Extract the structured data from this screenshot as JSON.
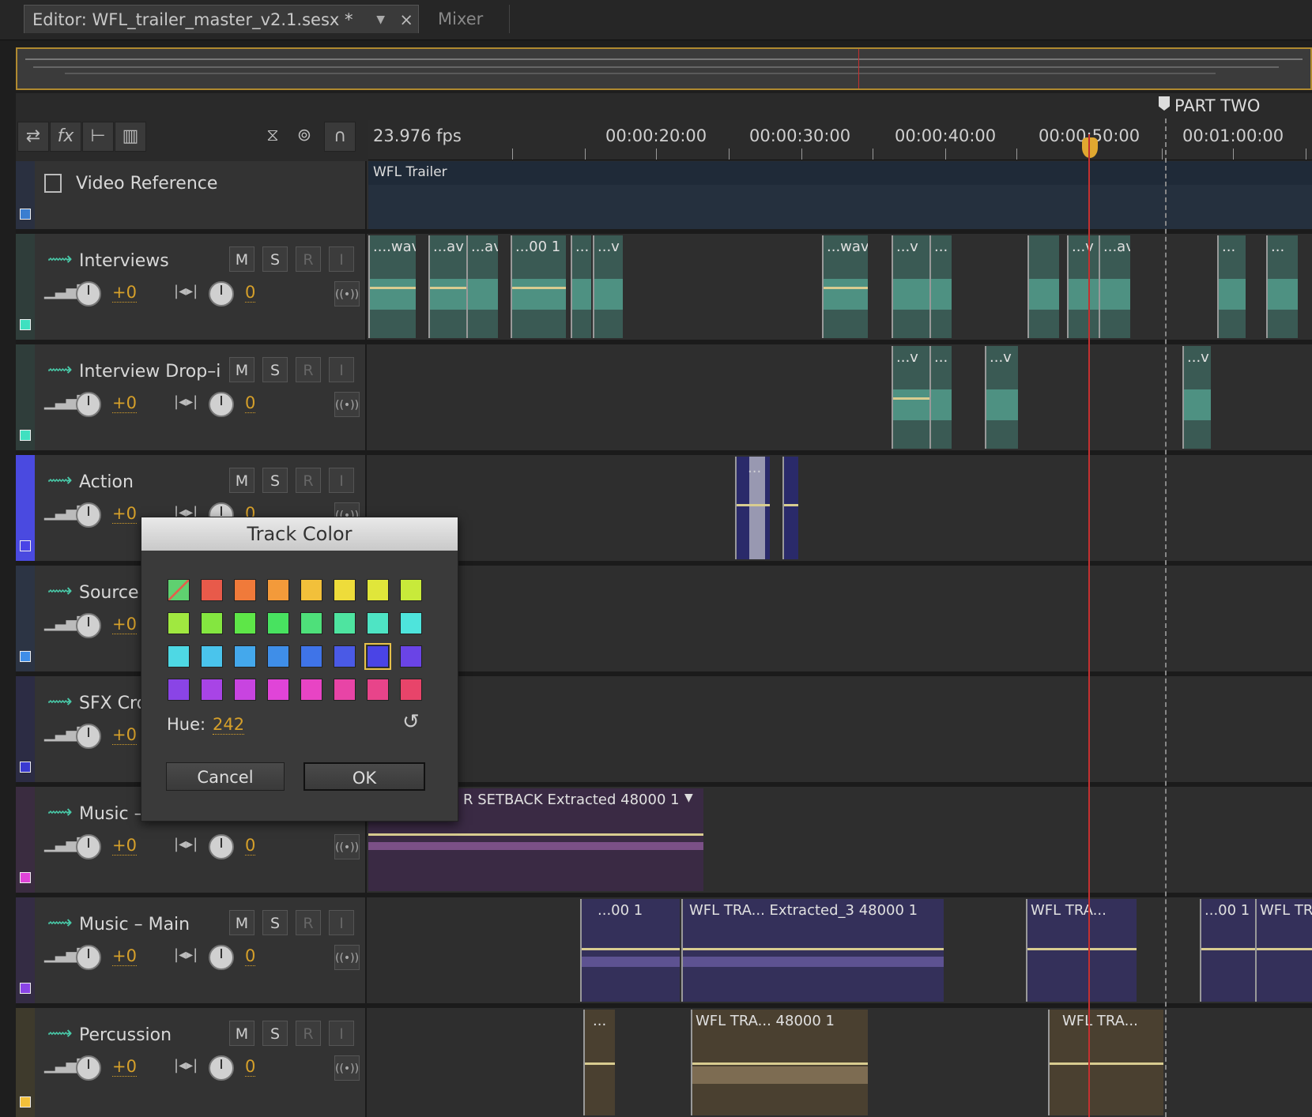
{
  "tabs": {
    "editor": "Editor: WFL_trailer_master_v2.1.sesx *",
    "mixer": "Mixer",
    "menu_glyph": "▼",
    "close_glyph": "×"
  },
  "marker": {
    "label": "PART TWO"
  },
  "toolbar": {
    "icons": [
      "swap-icon",
      "fx-icon",
      "send-icon",
      "meter-icon",
      "metronome-icon",
      "record-icon",
      "snap-magnet-icon"
    ],
    "glyphs": [
      "⇄",
      "fx",
      "⊢",
      "▥",
      "⧖",
      "⊚",
      "∩"
    ]
  },
  "ruler": {
    "fps": "23.976 fps",
    "times": [
      "00:00:20:00",
      "00:00:30:00",
      "00:00:40:00",
      "00:00:50:00",
      "00:01:00:00"
    ]
  },
  "video": {
    "name": "Video Reference",
    "clip": "WFL Trailer"
  },
  "tracks": [
    {
      "name": "Interviews",
      "vol": "+0",
      "pan": "0",
      "color": "#3fc2a0"
    },
    {
      "name": "Interview Drop–i",
      "vol": "+0",
      "pan": "0",
      "color": "#3fc2a0"
    },
    {
      "name": "Action",
      "vol": "+0",
      "pan": "0",
      "color": "#4a4ae0"
    },
    {
      "name": "Source",
      "vol": "+0",
      "pan": "0",
      "color": "#3a7ed0"
    },
    {
      "name": "SFX Cro",
      "vol": "+0",
      "pan": "0",
      "color": "#3a3ad0"
    },
    {
      "name": "Music –",
      "vol": "+0",
      "pan": "0",
      "color": "#c040c0"
    },
    {
      "name": "Music – Main",
      "vol": "+0",
      "pan": "0",
      "color": "#7a40e0"
    },
    {
      "name": "Percussion",
      "vol": "+0",
      "pan": "0",
      "color": "#d0b040"
    }
  ],
  "buttons": {
    "m": "M",
    "s": "S",
    "r": "R",
    "i": "I"
  },
  "clips": {
    "interviews": [
      "....wav",
      "...av",
      "...av",
      "...00 1",
      "...",
      "...v",
      "...wav",
      "...v",
      "...",
      "...v",
      "...av",
      "...",
      "..."
    ],
    "drop": [
      "...v",
      "...",
      "...v",
      "...v"
    ],
    "action": [
      "..."
    ],
    "music_sec": "R SETBACK Extracted 48000 1",
    "music_main": [
      "...00 1",
      "WFL TRA... Extracted_3 48000 1",
      "WFL TRA...",
      "...00 1",
      "WFL TR"
    ],
    "percussion": [
      "...",
      "WFL TRA... 48000 1",
      "WFL TRA..."
    ]
  },
  "dialog": {
    "title": "Track Color",
    "hue_label": "Hue:",
    "hue_value": "242",
    "cancel": "Cancel",
    "ok": "OK",
    "selected_index": 22,
    "swatches": [
      "none",
      "#e85a4a",
      "#f07a3a",
      "#f39a3a",
      "#f2c03a",
      "#eedc3a",
      "#e0e63a",
      "#c8ea3a",
      "#a0e840",
      "#84e640",
      "#5ee648",
      "#48e260",
      "#4ee07a",
      "#4ee4a0",
      "#4ee4c4",
      "#4ee4dc",
      "#4ed8e4",
      "#4ac4ec",
      "#44a8ec",
      "#3f8ee8",
      "#3f74e8",
      "#4a5ae6",
      "#4a44e6",
      "#6a44e6",
      "#8a44e6",
      "#a844e6",
      "#c844e0",
      "#e044d8",
      "#e844c4",
      "#e844a6",
      "#e8448a",
      "#e8446a"
    ]
  }
}
